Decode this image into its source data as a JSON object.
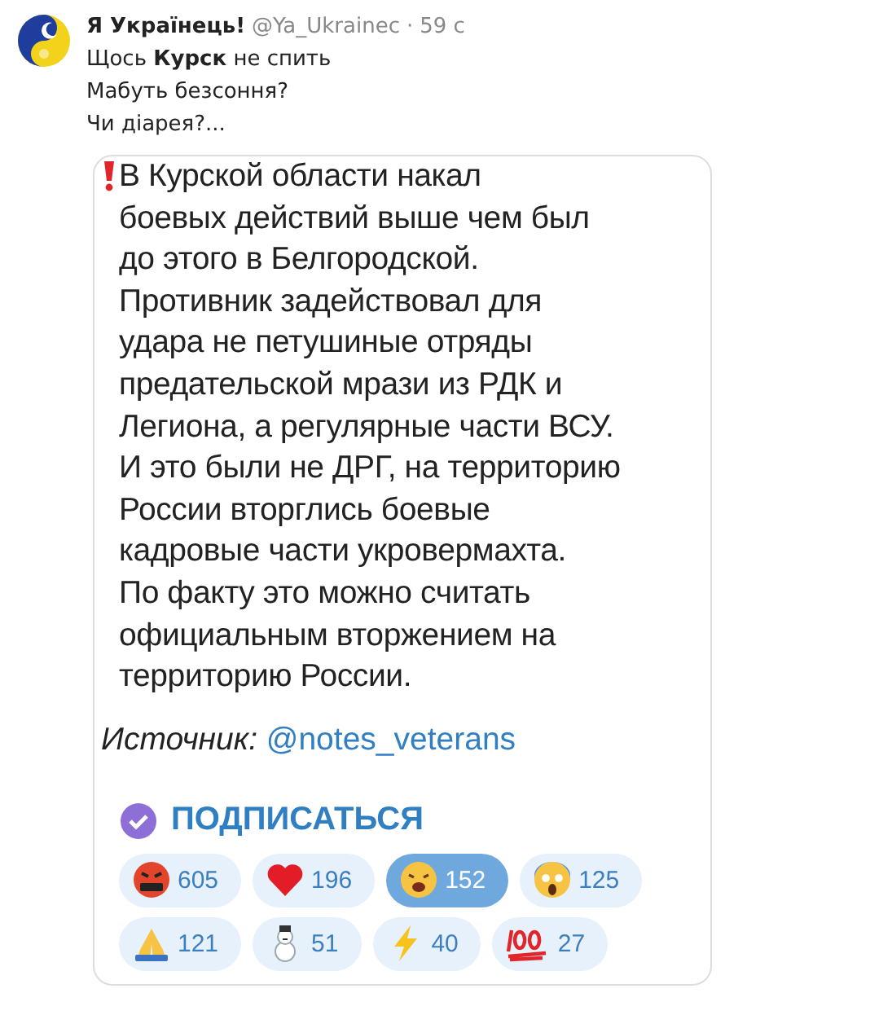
{
  "tweet": {
    "author": "Я Українець!",
    "handle": "@Ya_Ukrainec",
    "separator": "·",
    "time": "59 с",
    "text": "Щось **Курск** не спить\nМабуть безсоння?\nЧи діарея?..."
  },
  "post": {
    "text": "В Курской области накал\nбоевых действий выше чем был\nдо этого в Белгородской.\nПротивник задействовал для\nудара не петушиные отряды\nпредательской мрази из РДК и\nЛегиона, а регулярные части ВСУ.\nИ это были не ДРГ, на территорию\nРоссии вторглись боевые\nкадровые части укровермахта.\nПо факту это можно считать\nофициальным вторжением на\nтерриторию России.",
    "source_label": "Источник:",
    "source_link": "@notes_veterans",
    "subscribe": "ПОДПИСАТЬСЯ",
    "reactions": [
      {
        "kind": "angry",
        "count": "605",
        "selected": false
      },
      {
        "kind": "heart",
        "count": "196",
        "selected": false
      },
      {
        "kind": "tired",
        "count": "152",
        "selected": true
      },
      {
        "kind": "scream",
        "count": "125",
        "selected": false
      },
      {
        "kind": "pray",
        "count": "121",
        "selected": false
      },
      {
        "kind": "snowman",
        "count": "51",
        "selected": false
      },
      {
        "kind": "zap",
        "count": "40",
        "selected": false
      },
      {
        "kind": "hundred",
        "count": "27",
        "selected": false
      }
    ]
  }
}
